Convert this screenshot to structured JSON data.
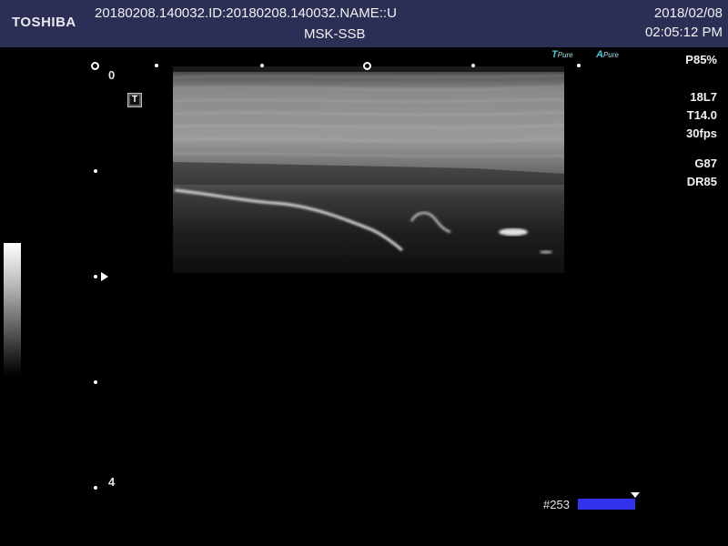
{
  "header": {
    "brand": "TOSHIBA",
    "study_id": "20180208.140032.ID:20180208.140032.NAME::U",
    "preset": "MSK-SSB",
    "date": "2018/02/08",
    "time": "02:05:12 PM"
  },
  "depth_scale": {
    "top_label": "0",
    "bottom_label": "4"
  },
  "params": {
    "power": "P85%",
    "probe": "18L7",
    "frequency": "T14.0",
    "frame_rate": "30fps",
    "gain": "G87",
    "dynamic_range": "DR85"
  },
  "pure_icons": [
    {
      "prefix": "T",
      "label": "Pure"
    },
    {
      "prefix": "A",
      "label": "Pure"
    }
  ],
  "frame_counter": {
    "label": "#253"
  },
  "t_marker": {
    "label": "T"
  }
}
